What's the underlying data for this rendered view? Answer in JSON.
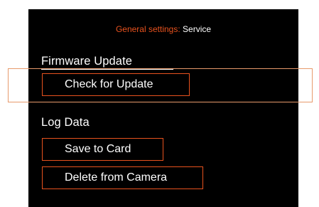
{
  "header": {
    "prefix": "General settings:",
    "page_name": "Service"
  },
  "firmware": {
    "title": "Firmware Update",
    "check_label": "Check for Update"
  },
  "log_data": {
    "title": "Log Data",
    "save_label": "Save to Card",
    "delete_label": "Delete from Camera"
  },
  "colors": {
    "accent": "#e8521e",
    "background": "#000000",
    "text": "#ffffff",
    "selection": "#e79a6c"
  }
}
